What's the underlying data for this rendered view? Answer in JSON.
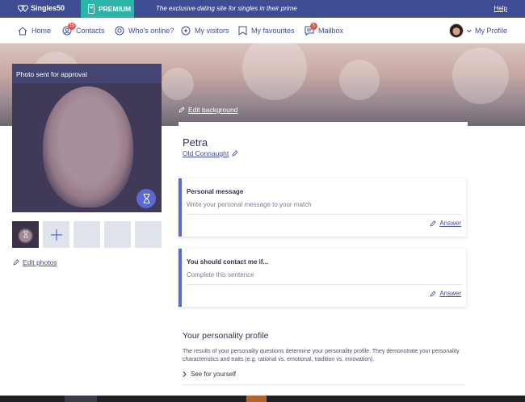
{
  "topbar": {
    "logo": "Singles50",
    "premium": "PREMIUM",
    "tagline": "The exclusive dating site for singles in their prime",
    "help": "Help"
  },
  "nav": {
    "home": "Home",
    "contacts": "Contacts",
    "contacts_badge": "15",
    "whos_online": "Who's online?",
    "my_visitors": "My visitors",
    "my_favourites": "My favourites",
    "mailbox": "Mailbox",
    "mailbox_badge": "1",
    "my_profile": "My Profile"
  },
  "cover": {
    "edit_background": "Edit background"
  },
  "photo": {
    "status": "Photo sent for approval",
    "edit_photos": "Edit photos"
  },
  "profile": {
    "name": "Petra",
    "location": "Old Connaught"
  },
  "cards": [
    {
      "title": "Personal message",
      "placeholder": "Write your personal message to your match",
      "answer": "Answer"
    },
    {
      "title": "You should contact me if...",
      "placeholder": "Complete this sentence",
      "answer": "Answer"
    }
  ],
  "personality": {
    "title": "Your personality profile",
    "text": "The results of your personality questions determine your personality profile. They demonstrate your personality characteristics and traits (e.g. rational vs. emotional, tradition vs. innovation).",
    "link": "See for yourself"
  },
  "colors": {
    "topbar": "#3f4d95",
    "premium": "#2bb5a8",
    "accent": "#5b6ad2",
    "badge": "#e2574c"
  }
}
